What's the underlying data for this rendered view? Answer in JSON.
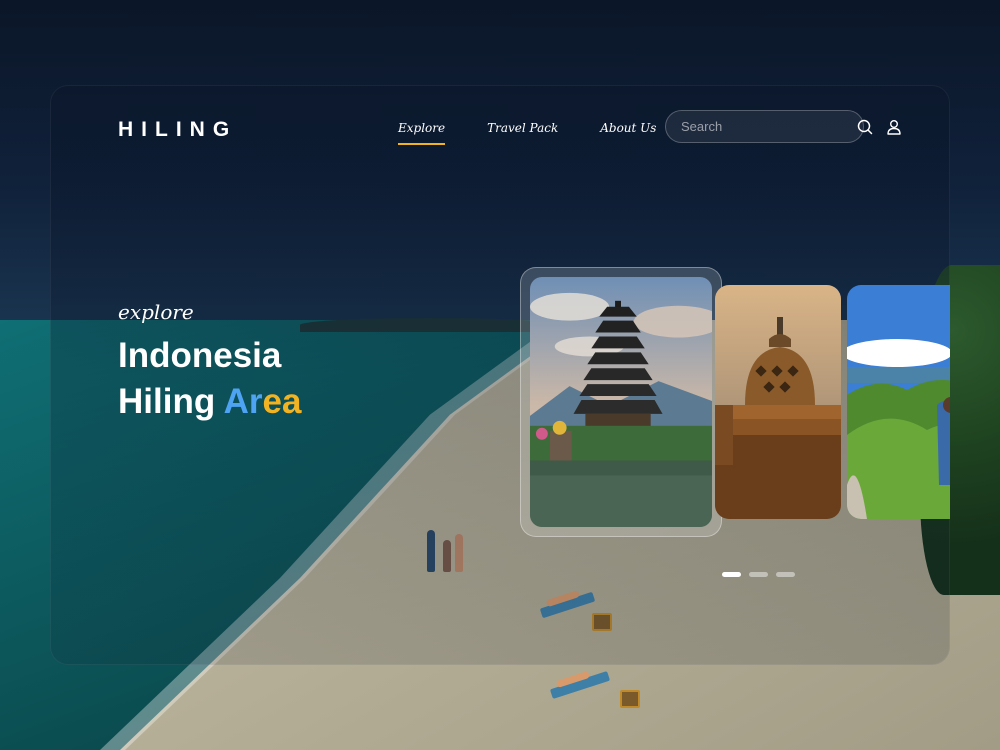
{
  "brand": {
    "logo": "HILING"
  },
  "nav": {
    "items": [
      {
        "label": "Explore",
        "active": true
      },
      {
        "label": "Travel Pack",
        "active": false
      },
      {
        "label": "About Us",
        "active": false
      }
    ]
  },
  "search": {
    "placeholder": "Search",
    "value": ""
  },
  "hero": {
    "eyebrow": "explore",
    "line1": "Indonesia",
    "line2_start": "Hiling ",
    "line2_blue": "Ar",
    "line2_yellow": "ea"
  },
  "colors": {
    "accent_yellow": "#f2b322",
    "accent_blue": "#4ea3f2",
    "text": "#ffffff"
  },
  "icons": {
    "search": "search-icon",
    "user": "user-icon"
  },
  "carousel": {
    "cards": [
      {
        "id": "pura-ulun-danu",
        "featured": true
      },
      {
        "id": "borobudur-stupa",
        "featured": false
      },
      {
        "id": "komodo-hills",
        "featured": false
      }
    ],
    "active_index": 0,
    "dot_count": 3
  }
}
